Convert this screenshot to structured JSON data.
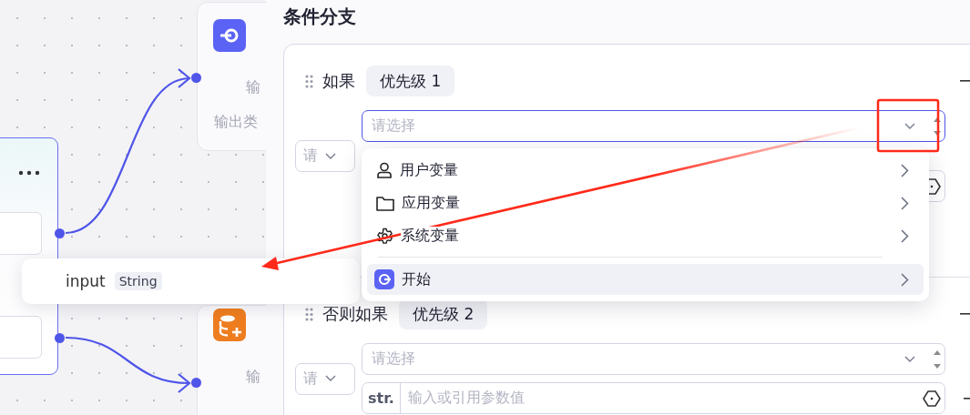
{
  "canvas": {
    "end_node": {
      "labels": [
        "输",
        "输出类"
      ]
    },
    "db_node": {
      "labels": [
        "输"
      ]
    }
  },
  "panel": {
    "title": "条件分支",
    "branches": [
      {
        "label": "如果",
        "priority": "优先级 1",
        "operator": "请",
        "condition": {
          "placeholder": "请选择",
          "focused": true
        }
      },
      {
        "label": "否则如果",
        "priority": "优先级 2",
        "operator": "请",
        "condition": {
          "placeholder": "请选择",
          "focused": false
        },
        "value": {
          "prefix": "str.",
          "placeholder": "输入或引用参数值"
        }
      }
    ]
  },
  "variable_menu": {
    "items": [
      {
        "kind": "user",
        "label": "用户变量",
        "selected": false
      },
      {
        "kind": "folder",
        "label": "应用变量",
        "selected": false
      },
      {
        "kind": "gear",
        "label": "系统变量",
        "selected": false
      },
      {
        "kind": "start",
        "label": "开始",
        "selected": true
      }
    ]
  },
  "output_popup": {
    "name": "input",
    "type": "String"
  }
}
